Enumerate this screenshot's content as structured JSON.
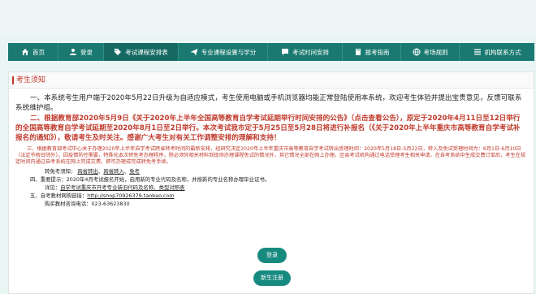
{
  "nav": {
    "items": [
      {
        "label": "首页",
        "icon": "home-icon"
      },
      {
        "label": "登录",
        "icon": "user-icon"
      },
      {
        "label": "考试课程安排表",
        "icon": "tag-icon"
      },
      {
        "label": "专业课程设置与学分",
        "icon": "send-icon"
      },
      {
        "label": "考试时间安排",
        "icon": "chat-icon"
      },
      {
        "label": "报考指南",
        "icon": "book-icon"
      },
      {
        "label": "考场规则",
        "icon": "globe-icon"
      },
      {
        "label": "机构联系方式",
        "icon": "list-icon"
      }
    ]
  },
  "notice": {
    "title": "考生须知",
    "p1": "一、本系统考生用户端于2020年5月22日升级为自适应模式，考生使用电脑或手机浏览器均能正常登陆使用本系统，欢迎考生体验并提出宝贵意见，反馈可联系系统维护组。",
    "p2": "二、根据教育部2020年5月9日《关于2020年上半年全国高等教育自学考试延期举行时间安排的公告》（点击查看公告），原定于2020年4月11日至12日举行的全国高等教育自学考试延期至2020年8月1日至2日举行。本次考试我市定于5月25日至5月28日将进行补报名（《关于2020年上半年重庆市高等教育自学考试补报名的通知》），敬请考生及时关注。感谢广大考生对有关工作调整安排的理解和支持！",
    "p3": "三、根据教育部考试中心关于办理2020年上半年自学考试跨省转考时间的最新安排，经研究决定2020年上半年重庆市高等教育自学考试转出受理时间：2020年5月18日-5月22日，转入及免试受理时间为：6月1日-6月10日（法定节假日除外）。因疫情防控需要，特殊化本次转免考办理程序，除必须凭相关材料到现场办理课程免试的情况外，其它情况全部在网上办理。区县考试机构通过电话受理考生相关申请，在自考系统中生成交费订单后，考生在规定时间内通过自考系统在网上完成交费，即可办理成完成转免考手续。",
    "transfer_label": "转免考须知：",
    "transfer_link1": "跨省转出",
    "transfer_link2": "跨省转入",
    "transfer_link3": "免考",
    "p4": "四、重要提示：2020年4月考试报名开始，启用新的专业代码及名称，并按新的专业名称办理毕业证书。",
    "detail_label": "详见：",
    "detail_link": "自学考试重庆市开考专业新旧代码及名称、类型对照表",
    "p5_label": "五、自考教材网购链接：",
    "p5_link": "http://shop70926379.taobao.com",
    "phone_label": "购买教材咨询电话：",
    "phone": "023-63623830"
  },
  "buttons": {
    "login": "登录",
    "register": "新生注册"
  },
  "colors": {
    "nav": "#1a7a72",
    "accent_red": "#c0392b",
    "button": "#178a80"
  }
}
